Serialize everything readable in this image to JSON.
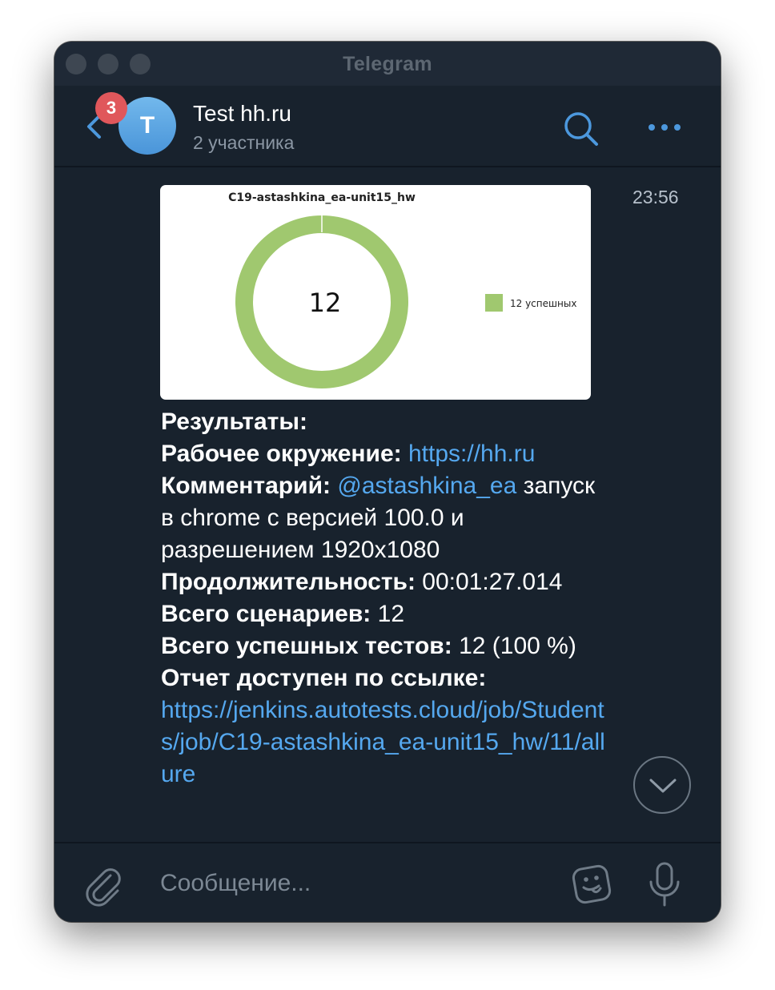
{
  "window": {
    "title": "Telegram"
  },
  "header": {
    "unread_count": "3",
    "avatar_letter": "T",
    "chat_title": "Test hh.ru",
    "chat_subtitle": "2 участника"
  },
  "message": {
    "time": "23:56",
    "chart": {
      "title": "C19-astashkina_ea-unit15_hw",
      "center_value": "12",
      "legend_label": "12 успешных",
      "color": "#a0c86f"
    },
    "results_label": "Результаты:",
    "env_label": "Рабочее окружение:",
    "env_link": "https://hh.ru",
    "comment_label": "Комментарий:",
    "comment_mention": "@astashkina_ea",
    "comment_text": "запуск в chrome с версией 100.0 и разрешением 1920x1080",
    "duration_label": "Продолжительность:",
    "duration_value": "00:01:27.014",
    "scenarios_label": "Всего сценариев:",
    "scenarios_value": "12",
    "passed_label": "Всего успешных тестов:",
    "passed_value": "12 (100 %)",
    "report_label": "Отчет доступен по ссылке:",
    "report_link": "https://jenkins.autotests.cloud/job/Students/job/C19-astashkina_ea-unit15_hw/11/allure"
  },
  "composer": {
    "placeholder": "Сообщение..."
  },
  "chart_data": {
    "type": "pie",
    "title": "C19-astashkina_ea-unit15_hw",
    "categories": [
      "12 успешных"
    ],
    "values": [
      12
    ],
    "center_label": "12",
    "legend_position": "right",
    "colors": [
      "#a0c86f"
    ]
  },
  "colors": {
    "accent": "#55a8ef",
    "badge": "#e0575b",
    "background": "#18222d"
  }
}
